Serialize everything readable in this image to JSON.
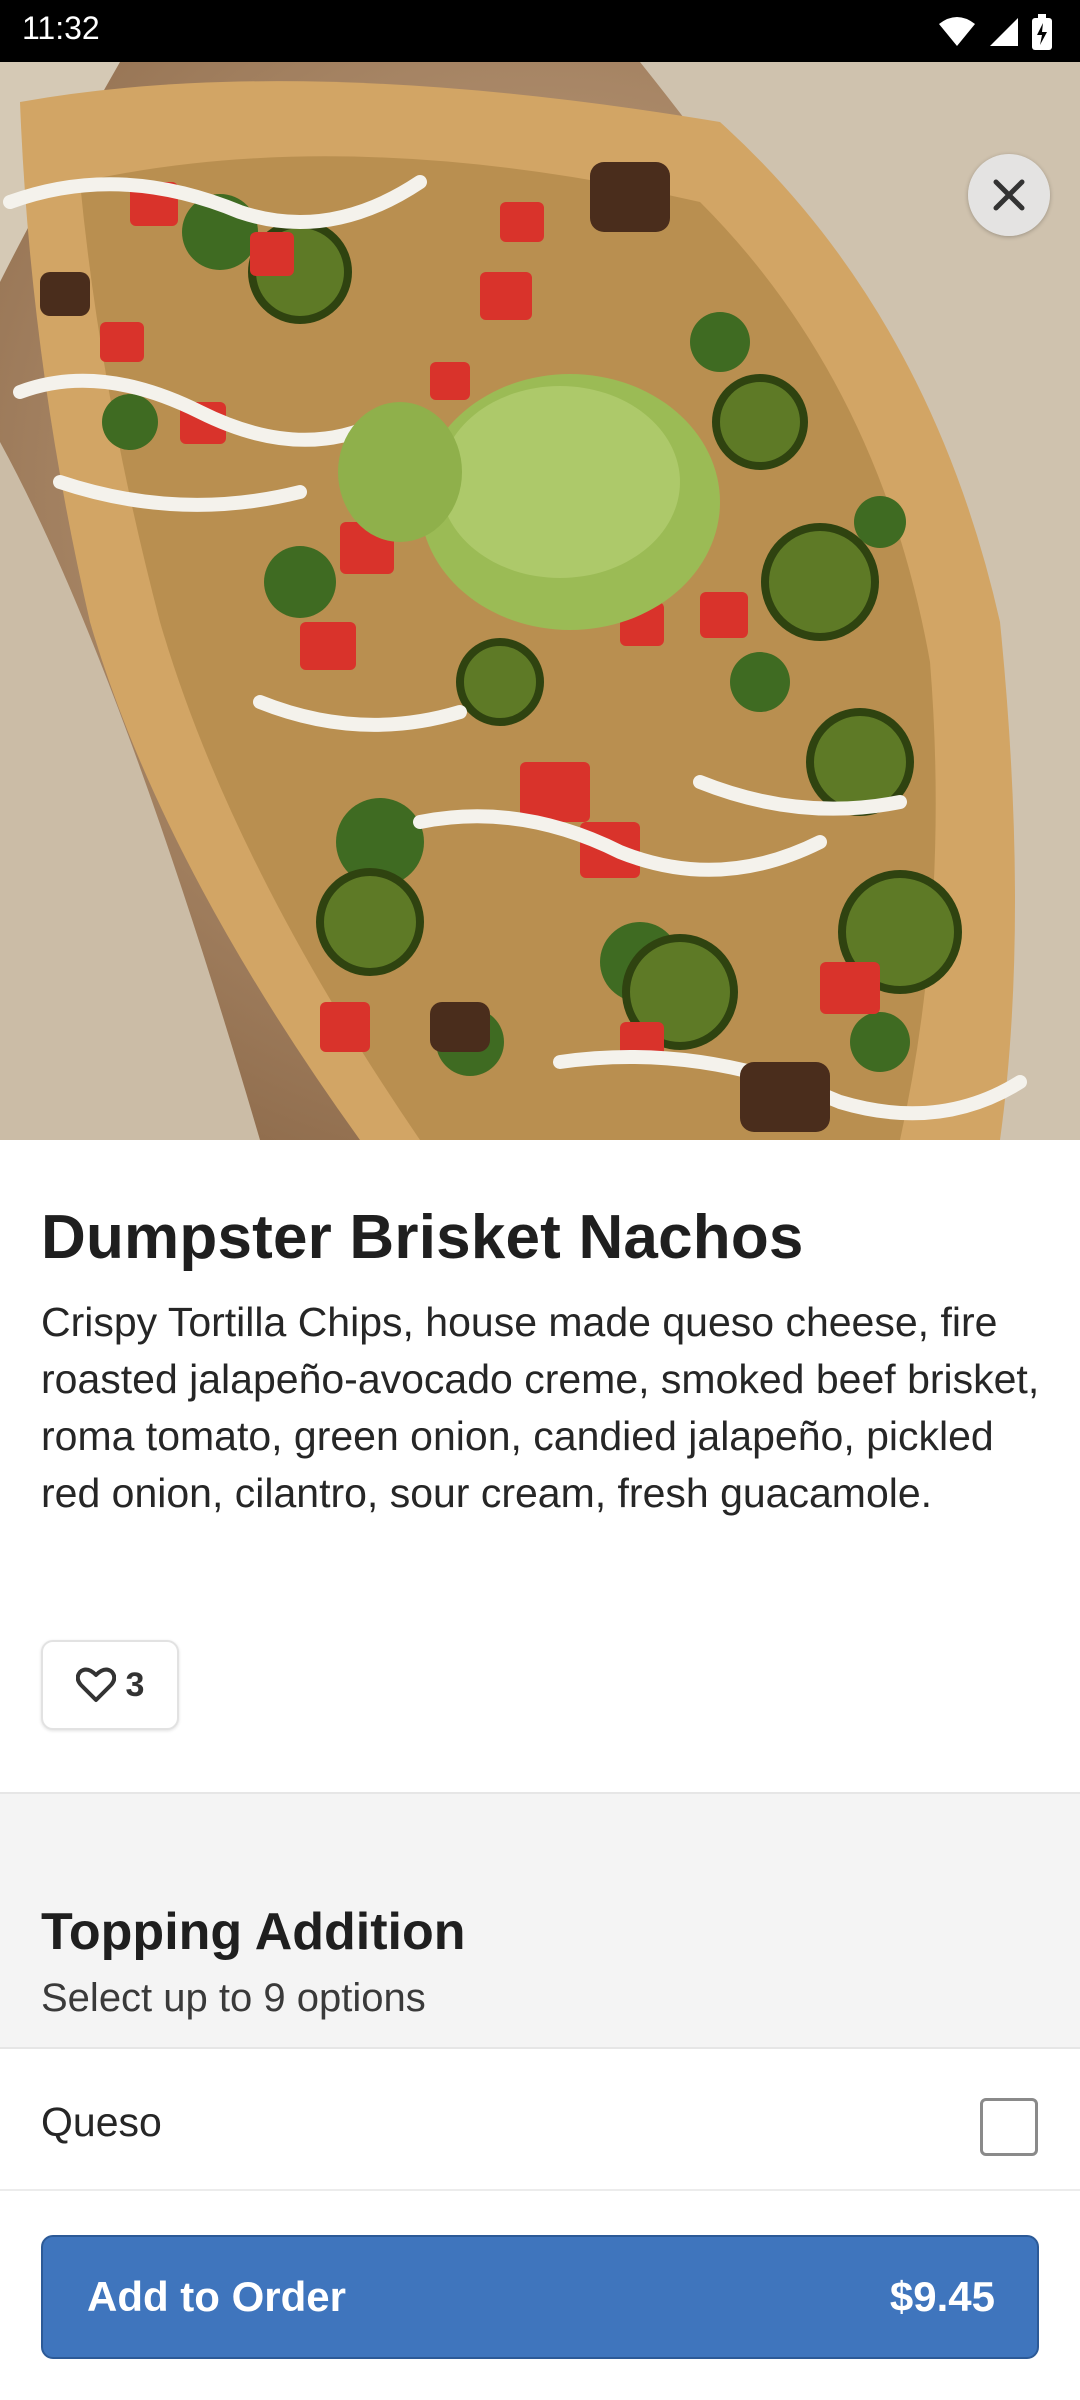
{
  "status": {
    "time": "11:32",
    "icons": [
      "wifi-icon",
      "signal-icon",
      "battery-charging-icon"
    ]
  },
  "hero": {
    "image": "nachos-photo",
    "close_icon": "close-icon"
  },
  "item": {
    "title": "Dumpster Brisket Nachos",
    "description": "Crispy Tortilla Chips, house made queso cheese, fire roasted jalapeño-avocado creme, smoked beef brisket, roma tomato, green onion, candied jalapeño, pickled red onion, cilantro, sour cream, fresh guacamole.",
    "likes": "3",
    "like_icon": "heart-icon"
  },
  "section": {
    "title": "Topping Addition",
    "subtitle": "Select up to 9 options"
  },
  "options": [
    {
      "label": "Queso",
      "checked": false
    }
  ],
  "footer": {
    "button_label": "Add to Order",
    "price": "$9.45"
  },
  "colors": {
    "accent": "#3f75bd",
    "status_bar": "#000000",
    "section_bg": "#f4f4f4"
  }
}
